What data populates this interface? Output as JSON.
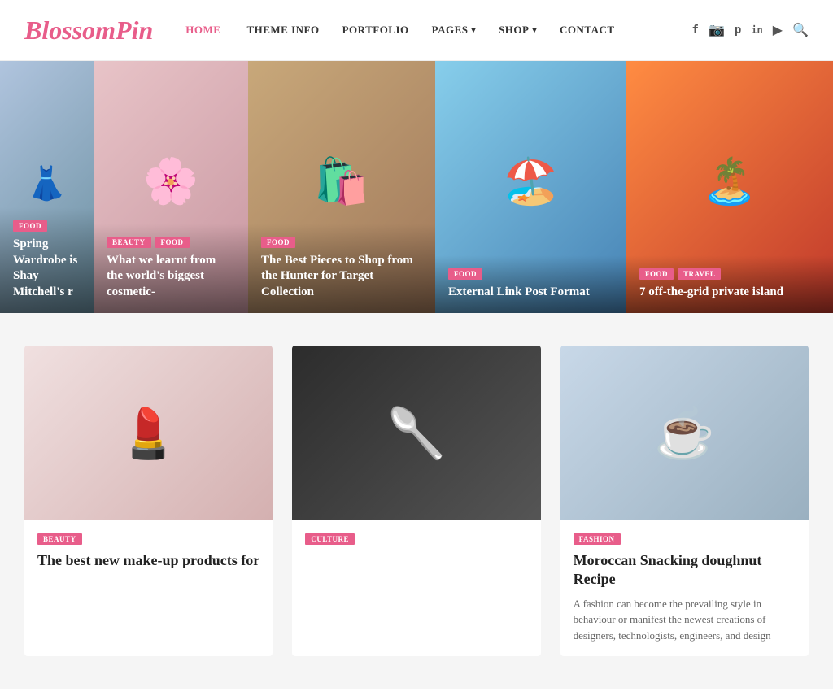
{
  "header": {
    "logo_text": "Blossom",
    "logo_accent": "Pin",
    "nav": [
      {
        "label": "HOME",
        "active": true,
        "has_dropdown": false
      },
      {
        "label": "THEME INFO",
        "active": false,
        "has_dropdown": false
      },
      {
        "label": "PORTFOLIO",
        "active": false,
        "has_dropdown": false
      },
      {
        "label": "PAGES",
        "active": false,
        "has_dropdown": true
      },
      {
        "label": "SHOP",
        "active": false,
        "has_dropdown": true
      },
      {
        "label": "CONTACT",
        "active": false,
        "has_dropdown": false
      }
    ],
    "icons": [
      "facebook",
      "instagram",
      "pinterest",
      "linkedin",
      "youtube",
      "search"
    ]
  },
  "hero": {
    "slides": [
      {
        "tags": [
          "FOOD"
        ],
        "title": "Spring Wardrobe is Shay Mitchell's r",
        "bg": "slide1"
      },
      {
        "tags": [
          "BEAUTY",
          "FOOD"
        ],
        "title": "What we learnt from the world's biggest cosmetic-",
        "bg": "slide2"
      },
      {
        "tags": [
          "FOOD"
        ],
        "title": "The Best Pieces to Shop from the Hunter for Target Collection",
        "bg": "slide3"
      },
      {
        "tags": [
          "FOOD"
        ],
        "title": "External Link Post Format",
        "bg": "slide4"
      },
      {
        "tags": [
          "FOOD",
          "TRAVEL"
        ],
        "title": "7 off-the-grid private island",
        "bg": "slide5"
      }
    ]
  },
  "cards": [
    {
      "tags": [
        "BEAUTY"
      ],
      "title": "The best new make-up products for",
      "desc": "",
      "bg": "card1",
      "fig": "💄"
    },
    {
      "tags": [
        "CULTURE"
      ],
      "title": "",
      "desc": "",
      "bg": "card2",
      "fig": "🥄"
    },
    {
      "tags": [
        "FASHION"
      ],
      "title": "Moroccan Snacking doughnut Recipe",
      "desc": "A fashion can become the prevailing style in behaviour or manifest the newest creations of designers, technologists, engineers, and design",
      "bg": "card3",
      "fig": "☕"
    }
  ],
  "icons": {
    "facebook": "f",
    "instagram": "📷",
    "pinterest": "p",
    "linkedin": "in",
    "youtube": "▶",
    "search": "🔍",
    "chevron": "▾"
  }
}
